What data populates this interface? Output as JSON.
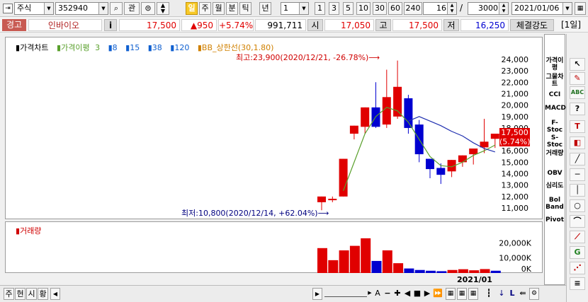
{
  "toolbar": {
    "market": "주식",
    "code": "352940",
    "search_icon": "search-icon",
    "btn_gwan": "관",
    "period_tabs": [
      "일",
      "주",
      "월",
      "분",
      "틱",
      "년"
    ],
    "period_selected": "일",
    "unit_value": "1",
    "unit_options": [
      "1",
      "3",
      "5",
      "10",
      "30",
      "60",
      "240"
    ],
    "count": "16",
    "count_sep": "/",
    "total": "3000",
    "date": "2021/01/06"
  },
  "info": {
    "alert": "경고",
    "name": "인바이오",
    "info_btn": "i",
    "price": "17,500",
    "change": "▲950",
    "change_pct": "+5.74%",
    "volume": "991,711",
    "open_label": "시",
    "open": "17,050",
    "high_label": "고",
    "high": "17,500",
    "low_label": "저",
    "low": "16,250",
    "strength": "체결강도",
    "day": "[1일]"
  },
  "price_panel": {
    "legend_head": "가격차트",
    "legend_ma_label": "가격이평",
    "legend_ma": [
      "3",
      "8",
      "15",
      "38",
      "120"
    ],
    "legend_bb": "BB_상한선(30,1.80)",
    "annot_high": "최고:23,900(2020/12/21, -26.78%)⟶",
    "annot_low": "최저:10,800(2020/12/14, +62.04%)⟶",
    "current_price": "17,500",
    "current_pct": "(5.74%)",
    "yticks": [
      "24,000",
      "23,000",
      "22,000",
      "21,000",
      "20,000",
      "19,000",
      "18,000",
      "17,000",
      "16,000",
      "15,000",
      "14,000",
      "13,000",
      "12,000",
      "11,000"
    ]
  },
  "volume_panel": {
    "title": "거래량",
    "yticks": [
      "20,000K",
      "10,000K",
      "0K"
    ]
  },
  "xaxis": {
    "label": "2021/01"
  },
  "right_bar": [
    "가격이평",
    "그물차트",
    "CCI",
    "MACD",
    "F-Stoc",
    "S-Stoc",
    "거래량",
    "OBV",
    "심리도",
    "Bol Band",
    "Pivot"
  ],
  "bottom": {
    "tabs": [
      "주",
      "현",
      "시",
      "황"
    ]
  },
  "colors": {
    "up": "#e00000",
    "down": "#0000d0",
    "ma": "#5aa02c"
  },
  "chart_data": {
    "type": "candlestick",
    "candles": [
      {
        "o": 11500,
        "h": 11500,
        "l": 10800,
        "c": 12000,
        "dir": "up"
      },
      {
        "o": 11700,
        "h": 12000,
        "l": 11500,
        "c": 11800,
        "dir": "up"
      },
      {
        "o": 12000,
        "h": 15300,
        "l": 12000,
        "c": 15300,
        "dir": "up"
      },
      {
        "o": 17500,
        "h": 18000,
        "l": 17000,
        "c": 18200,
        "dir": "up"
      },
      {
        "o": 18100,
        "h": 19300,
        "l": 17500,
        "c": 19800,
        "dir": "up"
      },
      {
        "o": 19800,
        "h": 22000,
        "l": 18000,
        "c": 18100,
        "dir": "down"
      },
      {
        "o": 18300,
        "h": 23100,
        "l": 18000,
        "c": 20700,
        "dir": "up"
      },
      {
        "o": 19000,
        "h": 23900,
        "l": 18800,
        "c": 21600,
        "dir": "up"
      },
      {
        "o": 20600,
        "h": 20900,
        "l": 17500,
        "c": 18000,
        "dir": "down"
      },
      {
        "o": 18300,
        "h": 18700,
        "l": 15000,
        "c": 15700,
        "dir": "down"
      },
      {
        "o": 15300,
        "h": 15300,
        "l": 13600,
        "c": 14400,
        "dir": "down"
      },
      {
        "o": 14500,
        "h": 14900,
        "l": 13100,
        "c": 13900,
        "dir": "down"
      },
      {
        "o": 14200,
        "h": 15000,
        "l": 13700,
        "c": 15200,
        "dir": "up"
      },
      {
        "o": 15000,
        "h": 15500,
        "l": 14600,
        "c": 15600,
        "dir": "up"
      },
      {
        "o": 15700,
        "h": 16100,
        "l": 14800,
        "c": 16200,
        "dir": "up"
      },
      {
        "o": 16300,
        "h": 18800,
        "l": 15800,
        "c": 16800,
        "dir": "up"
      },
      {
        "o": 17050,
        "h": 17500,
        "l": 16250,
        "c": 17500,
        "dir": "up"
      }
    ],
    "volumes": [
      {
        "v": 16500,
        "dir": "up"
      },
      {
        "v": 8500,
        "dir": "up"
      },
      {
        "v": 15000,
        "dir": "up"
      },
      {
        "v": 18000,
        "dir": "up"
      },
      {
        "v": 23000,
        "dir": "up"
      },
      {
        "v": 8000,
        "dir": "down"
      },
      {
        "v": 15000,
        "dir": "up"
      },
      {
        "v": 6500,
        "dir": "up"
      },
      {
        "v": 3000,
        "dir": "down"
      },
      {
        "v": 2000,
        "dir": "down"
      },
      {
        "v": 1500,
        "dir": "down"
      },
      {
        "v": 1200,
        "dir": "down"
      },
      {
        "v": 2000,
        "dir": "up"
      },
      {
        "v": 2500,
        "dir": "up"
      },
      {
        "v": 1800,
        "dir": "up"
      },
      {
        "v": 2600,
        "dir": "up"
      },
      {
        "v": 1500,
        "dir": "down"
      }
    ],
    "ma_line": [
      null,
      null,
      12500,
      15000,
      17500,
      19000,
      19800,
      19500,
      18500,
      17000,
      15500,
      14700,
      14600,
      15000,
      15600,
      16000,
      16500
    ],
    "bb_line": [
      null,
      null,
      null,
      null,
      null,
      null,
      null,
      null,
      18600,
      19000,
      18600,
      18200,
      17700,
      17300,
      16700,
      16200,
      15900
    ],
    "ylim": [
      10000,
      25000
    ],
    "vol_ylim": [
      0,
      30000
    ]
  }
}
